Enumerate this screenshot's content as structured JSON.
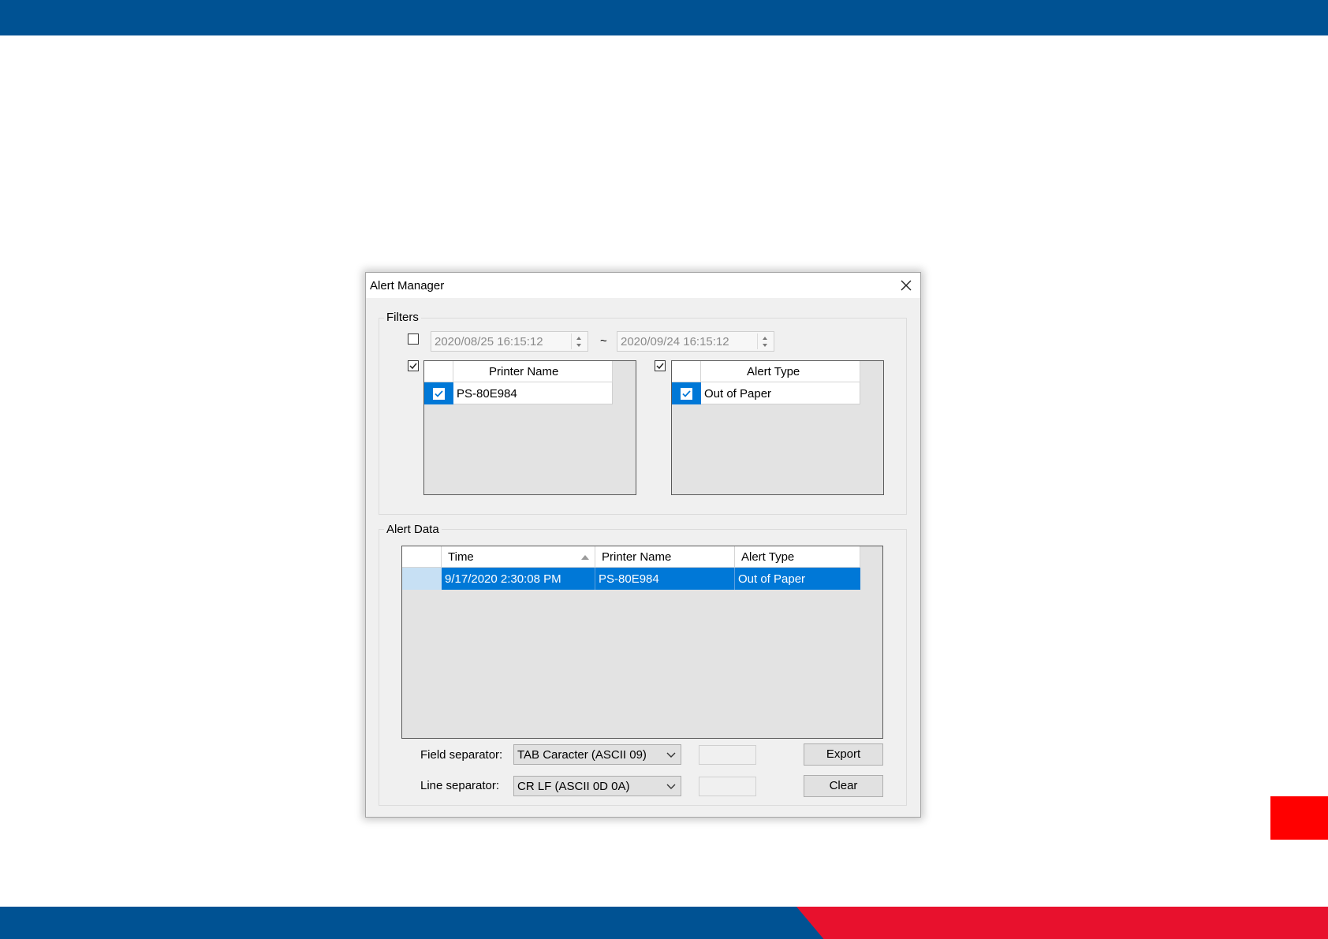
{
  "window": {
    "title": "Alert Manager"
  },
  "filters": {
    "label": "Filters",
    "date_enabled": false,
    "date_from": "2020/08/25 16:15:12",
    "separator": "~",
    "date_to": "2020/09/24 16:15:12",
    "printer_filter_enabled": true,
    "printer_list": {
      "header": "Printer Name",
      "items": [
        {
          "name": "PS-80E984",
          "checked": true
        }
      ]
    },
    "alert_filter_enabled": true,
    "alert_list": {
      "header": "Alert Type",
      "items": [
        {
          "name": "Out of Paper",
          "checked": true
        }
      ]
    }
  },
  "alert_data": {
    "label": "Alert Data",
    "columns": [
      "Time",
      "Printer Name",
      "Alert Type"
    ],
    "sort_column": "Time",
    "rows": [
      {
        "time": "9/17/2020 2:30:08 PM",
        "printer": "PS-80E984",
        "alert": "Out of Paper"
      }
    ]
  },
  "export": {
    "field_separator_label": "Field separator:",
    "field_separator_value": "TAB Caracter (ASCII 09)",
    "field_separator_custom": "",
    "line_separator_label": "Line separator:",
    "line_separator_value": "CR LF (ASCII 0D 0A)",
    "line_separator_custom": "",
    "export_button": "Export",
    "clear_button": "Clear"
  },
  "colors": {
    "brand_blue": "#005293",
    "brand_red": "#e8112d",
    "selection": "#0078d7"
  }
}
